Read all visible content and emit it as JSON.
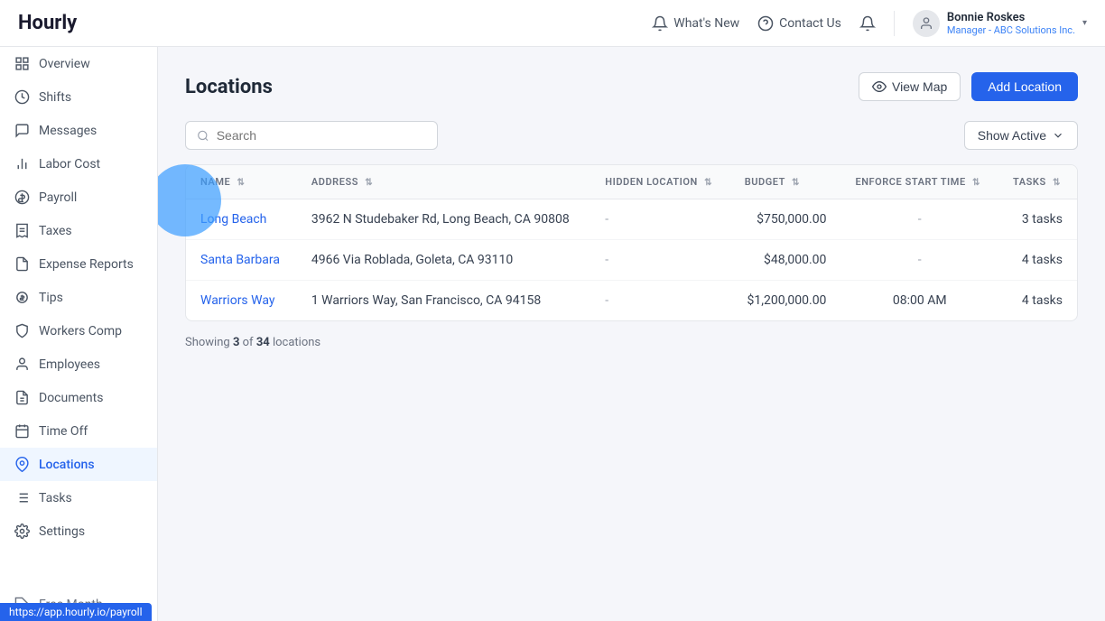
{
  "app": {
    "logo": "Hourly"
  },
  "header": {
    "whats_new_label": "What's New",
    "contact_us_label": "Contact Us",
    "user": {
      "name": "Bonnie Roskes",
      "role": "Manager - ABC Solutions Inc."
    }
  },
  "sidebar": {
    "items": [
      {
        "id": "overview",
        "label": "Overview",
        "icon": "grid"
      },
      {
        "id": "shifts",
        "label": "Shifts",
        "icon": "clock"
      },
      {
        "id": "messages",
        "label": "Messages",
        "icon": "chat"
      },
      {
        "id": "labor-cost",
        "label": "Labor Cost",
        "icon": "bar-chart"
      },
      {
        "id": "payroll",
        "label": "Payroll",
        "icon": "dollar"
      },
      {
        "id": "taxes",
        "label": "Taxes",
        "icon": "receipt"
      },
      {
        "id": "expense-reports",
        "label": "Expense Reports",
        "icon": "file"
      },
      {
        "id": "tips",
        "label": "Tips",
        "icon": "coin"
      },
      {
        "id": "workers-comp",
        "label": "Workers Comp",
        "icon": "shield"
      },
      {
        "id": "employees",
        "label": "Employees",
        "icon": "person"
      },
      {
        "id": "documents",
        "label": "Documents",
        "icon": "doc"
      },
      {
        "id": "time-off",
        "label": "Time Off",
        "icon": "calendar"
      },
      {
        "id": "locations",
        "label": "Locations",
        "icon": "pin",
        "active": true
      },
      {
        "id": "tasks",
        "label": "Tasks",
        "icon": "list"
      },
      {
        "id": "settings",
        "label": "Settings",
        "icon": "gear"
      },
      {
        "id": "free-month",
        "label": "Free Month",
        "icon": "tag"
      }
    ]
  },
  "main": {
    "page_title": "Locations",
    "view_map_label": "View Map",
    "add_location_label": "Add Location",
    "search_placeholder": "Search",
    "show_active_label": "Show Active",
    "table": {
      "columns": [
        {
          "key": "name",
          "label": "NAME"
        },
        {
          "key": "address",
          "label": "ADDRESS"
        },
        {
          "key": "hidden_location",
          "label": "HIDDEN LOCATION"
        },
        {
          "key": "budget",
          "label": "BUDGET"
        },
        {
          "key": "enforce_start_time",
          "label": "ENFORCE START TIME"
        },
        {
          "key": "tasks",
          "label": "TASKS"
        }
      ],
      "rows": [
        {
          "name": "Long Beach",
          "address": "3962 N Studebaker Rd, Long Beach, CA 90808",
          "hidden_location": "-",
          "budget": "$750,000.00",
          "enforce_start_time": "-",
          "tasks": "3 tasks"
        },
        {
          "name": "Santa Barbara",
          "address": "4966 Via Roblada, Goleta, CA 93110",
          "hidden_location": "-",
          "budget": "$48,000.00",
          "enforce_start_time": "-",
          "tasks": "4 tasks"
        },
        {
          "name": "Warriors Way",
          "address": "1 Warriors Way, San Francisco, CA 94158",
          "hidden_location": "-",
          "budget": "$1,200,000.00",
          "enforce_start_time": "08:00 AM",
          "tasks": "4 tasks"
        }
      ]
    },
    "footer": {
      "showing": "Showing",
      "count": "3",
      "of": "of",
      "total": "34",
      "label": "locations"
    }
  },
  "status_bar": {
    "url": "https://app.hourly.io/payroll"
  }
}
